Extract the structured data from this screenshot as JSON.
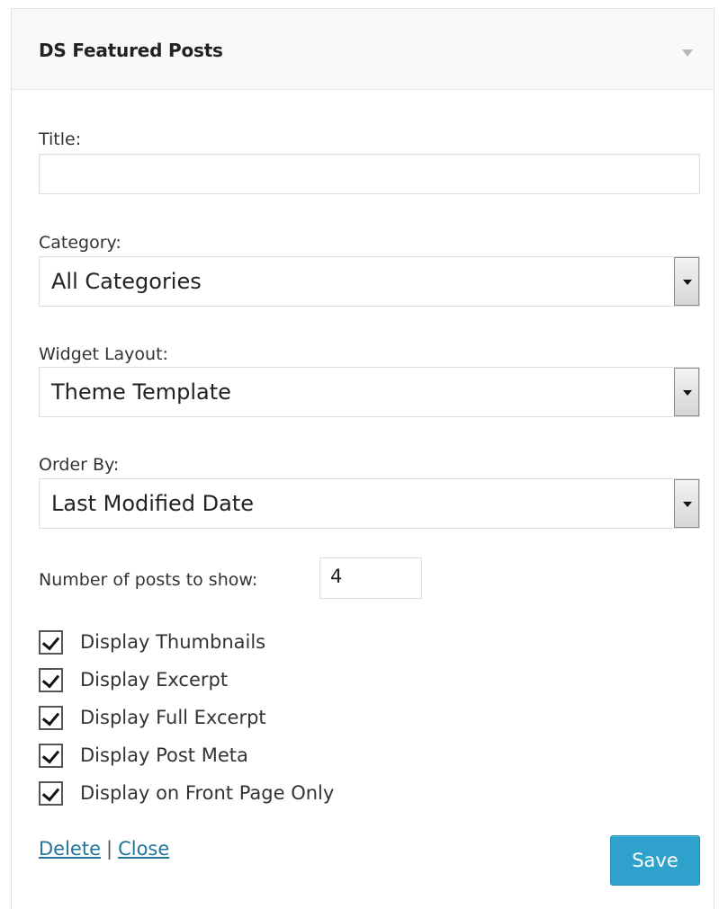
{
  "widget": {
    "title": "DS Featured Posts"
  },
  "form": {
    "title_label": "Title:",
    "title_value": "",
    "category_label": "Category:",
    "category_value": "All Categories",
    "layout_label": "Widget Layout:",
    "layout_value": "Theme Template",
    "order_label": "Order By:",
    "order_value": "Last Modified Date",
    "num_posts_label": "Number of posts to show:",
    "num_posts_value": "4",
    "checkboxes": [
      {
        "label": "Display Thumbnails",
        "checked": true
      },
      {
        "label": "Display Excerpt",
        "checked": true
      },
      {
        "label": "Display Full Excerpt",
        "checked": true
      },
      {
        "label": "Display Post Meta",
        "checked": true
      },
      {
        "label": "Display on Front Page Only",
        "checked": true
      }
    ]
  },
  "footer": {
    "delete_label": "Delete",
    "separator": "|",
    "close_label": "Close",
    "save_label": "Save"
  },
  "colors": {
    "link": "#21759b",
    "save_button": "#2ea2cc"
  },
  "icons": {
    "toggle": "triangle-down-icon",
    "checkbox": "checkmark-icon",
    "select_arrow": "chevron-down-icon"
  }
}
